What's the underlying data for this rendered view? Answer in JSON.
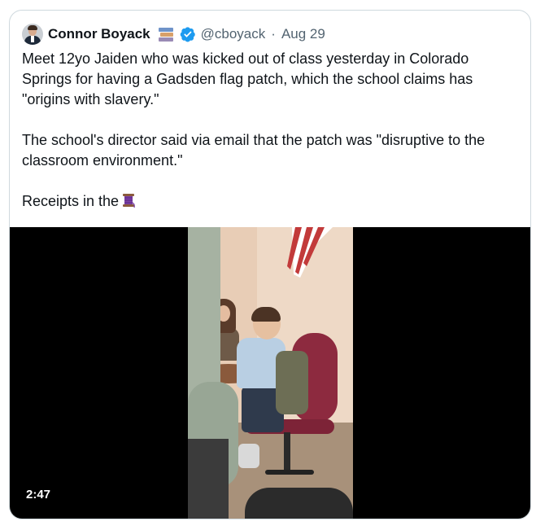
{
  "tweet": {
    "author_name": "Connor Boyack",
    "author_badge_icon": "books-emoji-icon",
    "verified_icon": "verified-badge-icon",
    "handle": "@cboyack",
    "separator": "·",
    "date": "Aug 29",
    "paragraphs": [
      "Meet 12yo Jaiden who was kicked out of class yesterday in Colorado Springs for having a Gadsden flag patch, which the school claims has \"origins with slavery.\"",
      "The school's director said via email that the patch was \"disruptive to the classroom environment.\"",
      "Receipts in the"
    ],
    "thread_icon": "thread-spool-emoji-icon",
    "media": {
      "type": "video",
      "duration": "2:47"
    }
  },
  "colors": {
    "text_primary": "#0f1419",
    "text_secondary": "#536471",
    "verified_blue": "#1d9bf0",
    "border": "#cfd9de",
    "video_background": "#000000"
  }
}
